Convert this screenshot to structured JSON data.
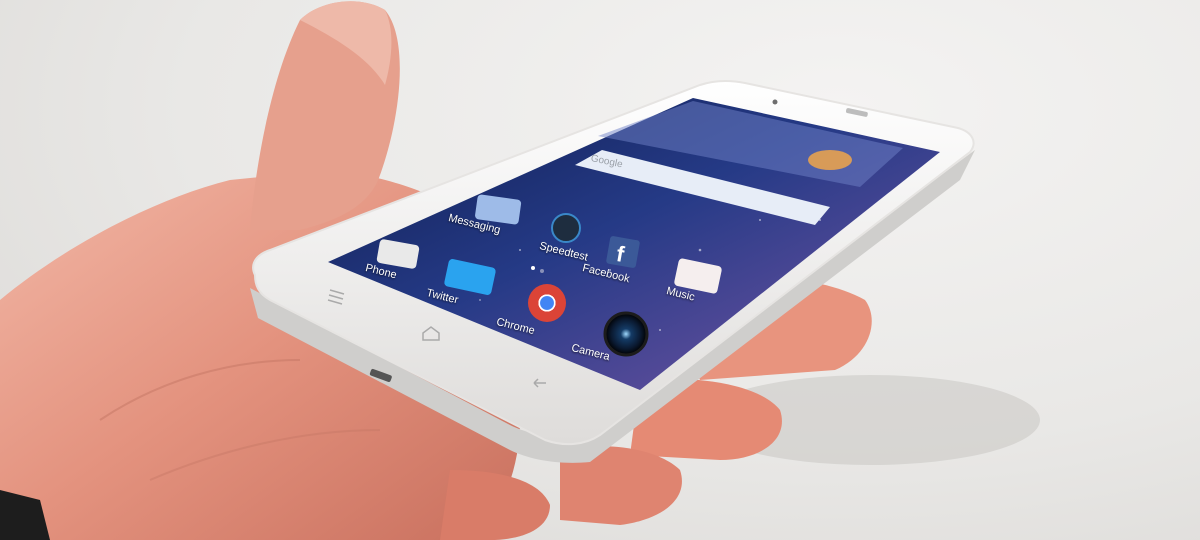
{
  "home_screen": {
    "search_widget": {
      "brand": "Google"
    },
    "apps": [
      {
        "label": "Messaging",
        "icon": "messaging-icon",
        "color": "#8ab4e8"
      },
      {
        "label": "Speedtest",
        "icon": "speedtest-icon",
        "color": "#1b2a3a"
      },
      {
        "label": "Facebook",
        "icon": "facebook-icon",
        "color": "#3b5998"
      },
      {
        "label": "Phone",
        "icon": "phone-icon",
        "color": "#e8e8e8"
      },
      {
        "label": "Twitter",
        "icon": "twitter-icon",
        "color": "#2aa3ef"
      },
      {
        "label": "Chrome",
        "icon": "chrome-icon",
        "color": "#db4437"
      },
      {
        "label": "Camera",
        "icon": "camera-icon",
        "color": "#12345a"
      },
      {
        "label": "Music",
        "icon": "music-icon",
        "color": "#f3eeee"
      }
    ]
  },
  "colors": {
    "phone_body": "#f4f4f2",
    "screen_top": "#1f2a66",
    "screen_bottom": "#7b5fa8",
    "skin": "#e79a87"
  }
}
